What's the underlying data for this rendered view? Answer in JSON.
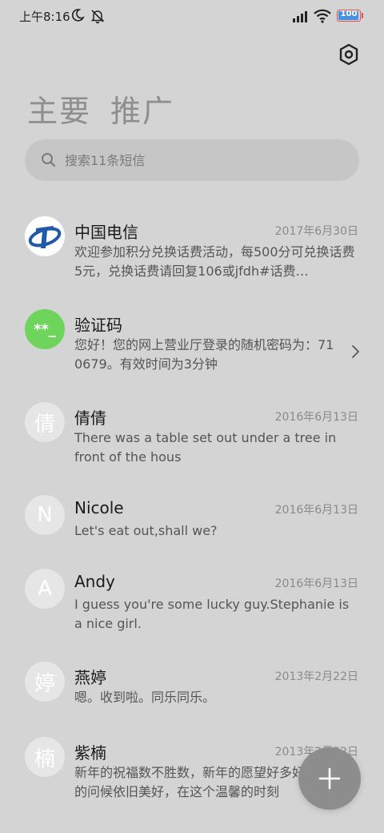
{
  "status_bar": {
    "time": "上午8:16",
    "battery_level": "100",
    "battery_color": "#4a90e2",
    "icons": [
      "moon-icon",
      "mute-icon",
      "signal-icon",
      "wifi-icon",
      "battery-icon"
    ]
  },
  "header": {
    "settings_icon": "hexagon-settings-icon",
    "tabs": [
      {
        "label": "主要"
      },
      {
        "label": "推广"
      }
    ]
  },
  "search": {
    "placeholder": "搜索11条短信",
    "value": ""
  },
  "conversations": [
    {
      "name": "中国电信",
      "date": "2017年6月30日",
      "preview": "欢迎参加积分兑换话费活动，每500分可兑换话费5元，兑换话费请回复106或jfdh#话费…",
      "avatar_type": "telecom-logo"
    },
    {
      "name": "验证码",
      "date": "",
      "preview": "您好！您的网上营业厅登录的随机密码为：710679。有效时间为3分钟",
      "avatar_type": "code",
      "avatar_text": "**_"
    },
    {
      "name": "倩倩",
      "date": "2016年6月13日",
      "preview": "There was a table set out under a tree in front of the hous",
      "avatar_type": "letter",
      "avatar_text": "倩"
    },
    {
      "name": "Nicole",
      "date": "2016年6月13日",
      "preview": "Let's eat out,shall we?",
      "avatar_type": "letter",
      "avatar_text": "N"
    },
    {
      "name": "Andy",
      "date": "2016年6月13日",
      "preview": "I guess you're some lucky guy.Stephanie is a nice girl.",
      "avatar_type": "letter",
      "avatar_text": "A"
    },
    {
      "name": "燕婷",
      "date": "2013年2月22日",
      "preview": "嗯。收到啦。同乐同乐。",
      "avatar_type": "letter",
      "avatar_text": "婷"
    },
    {
      "name": "紫楠",
      "date": "2013年2月22日",
      "preview": "新年的祝福数不胜数，新年的愿望好多好多，新年的问候依旧美好，在这个温馨的时刻",
      "avatar_type": "letter",
      "avatar_text": "楠"
    }
  ],
  "fab": {
    "icon": "plus-icon"
  },
  "colors": {
    "background": "#d4d4d4",
    "search_bg": "#c6c6c6",
    "code_avatar": "#6fd45c",
    "telecom_blue": "#1f5aa8",
    "fab": "#8d8d8d"
  }
}
